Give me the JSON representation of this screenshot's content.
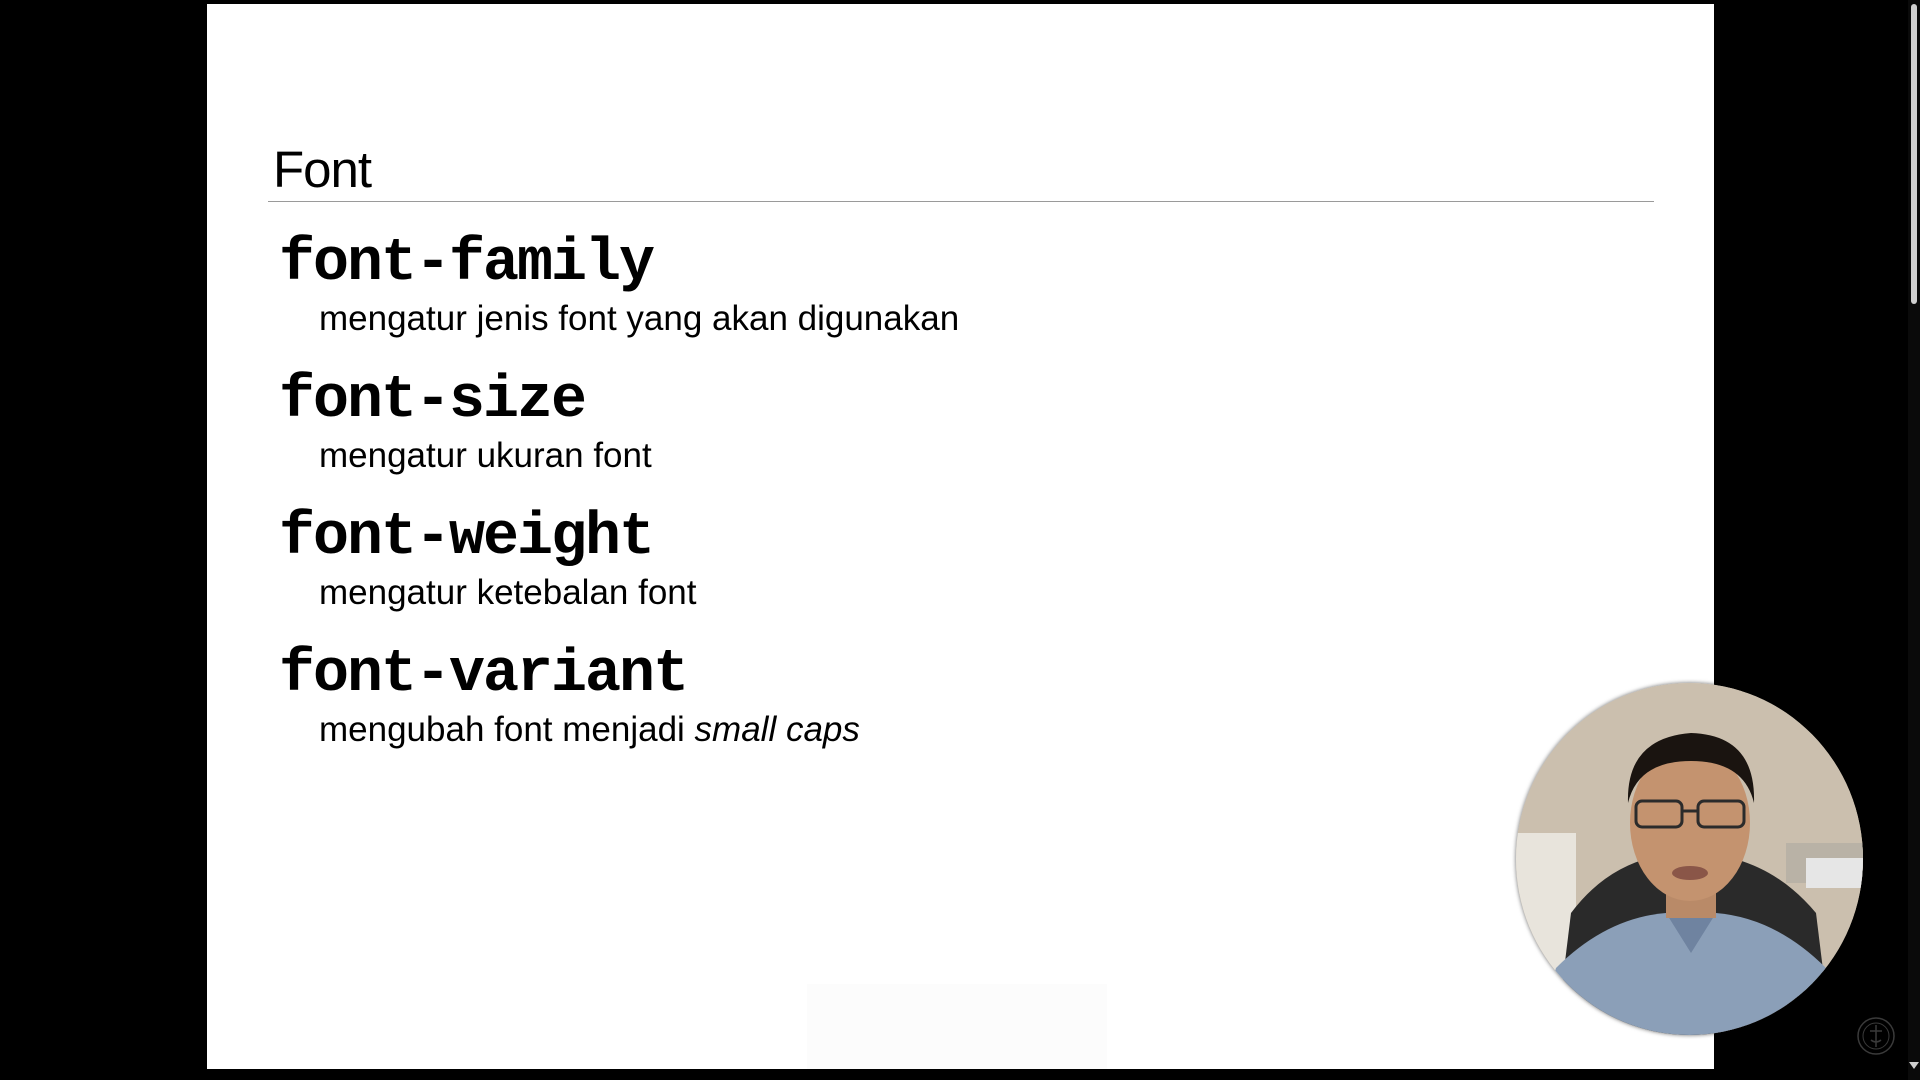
{
  "slide": {
    "title": "Font",
    "properties": [
      {
        "name": "font-family",
        "description": "mengatur jenis font yang akan digunakan"
      },
      {
        "name": "font-size",
        "description": "mengatur ukuran font"
      },
      {
        "name": "font-weight",
        "description": "mengatur ketebalan font"
      },
      {
        "name": "font-variant",
        "description_prefix": "mengubah font menjadi ",
        "description_emphasis": "small caps"
      }
    ]
  },
  "icons": {
    "webcam": "presenter-webcam-overlay",
    "seal": "watermark-seal-icon",
    "scroll_arrow": "chevron-down-icon"
  },
  "colors": {
    "background": "#000000",
    "slide": "#ffffff",
    "text": "#000000",
    "rule": "#9a9a9a"
  }
}
